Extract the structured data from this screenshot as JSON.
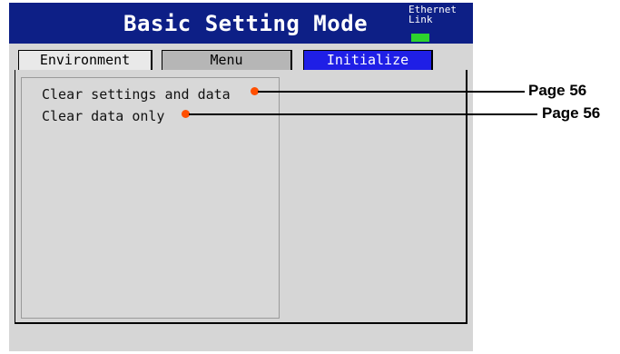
{
  "window": {
    "title": "Basic Setting Mode",
    "status_line1": "Ethernet",
    "status_line2": "Link"
  },
  "tabs": [
    {
      "label": "Environment",
      "active": false
    },
    {
      "label": "Menu",
      "active": false
    },
    {
      "label": "Initialize",
      "active": true
    }
  ],
  "items": [
    {
      "label": "Clear settings and data",
      "page_ref": "Page 56"
    },
    {
      "label": "Clear data only",
      "page_ref": "Page 56"
    }
  ],
  "colors": {
    "titlebar": "#0d1f86",
    "active_tab": "#1f1fe6",
    "link_led": "#2dd32d",
    "callout_dot": "#ff4f00"
  }
}
